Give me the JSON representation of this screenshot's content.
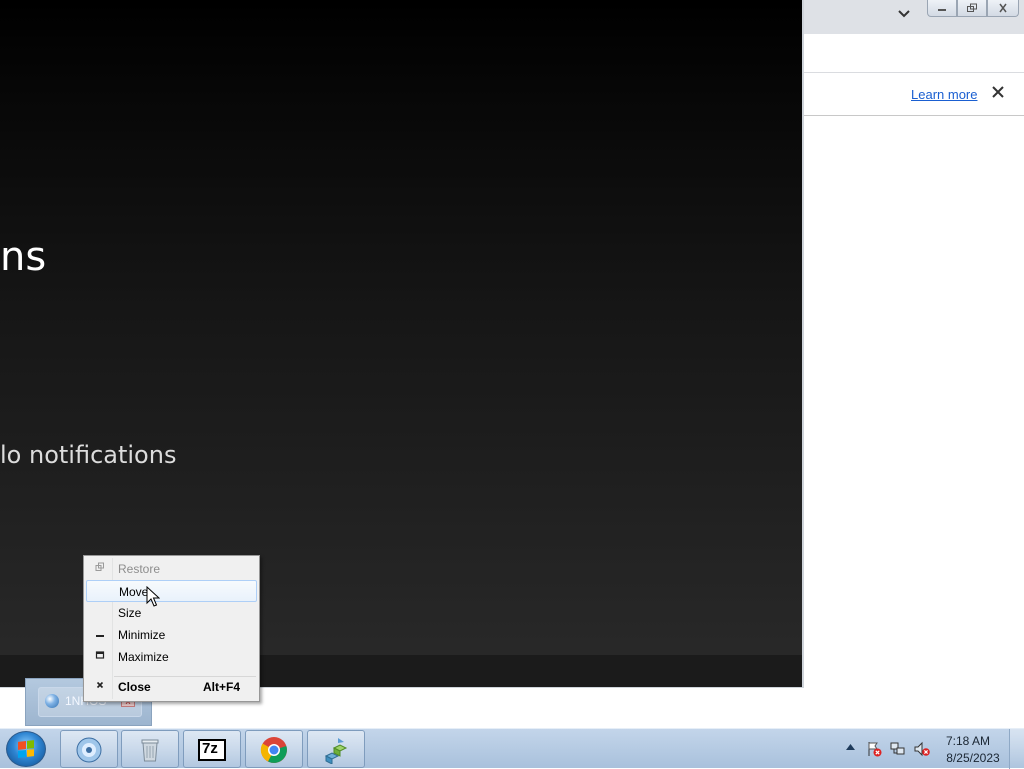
{
  "chrome": {
    "infobar": {
      "learn_more": "Learn more"
    }
  },
  "notifications_window": {
    "title_partial": "ns",
    "empty_partial": "lo notifications"
  },
  "thumbnail": {
    "label": "1NHOS"
  },
  "context_menu": {
    "items": [
      {
        "label": "Restore",
        "icon": "restore-icon",
        "disabled": true
      },
      {
        "label": "Move",
        "icon": "",
        "highlighted": true
      },
      {
        "label": "Size",
        "icon": ""
      },
      {
        "label": "Minimize",
        "icon": "minimize-icon"
      },
      {
        "label": "Maximize",
        "icon": "maximize-icon"
      },
      {
        "label": "Close",
        "icon": "close-icon",
        "accelerator": "Alt+F4",
        "bold": true
      }
    ]
  },
  "taskbar": {
    "pinned": [
      "media-player",
      "recycle-bin",
      "7zip",
      "chrome",
      "network-app"
    ],
    "seven_zip_label": "7z",
    "clock": {
      "time": "7:18 AM",
      "date": "8/25/2023"
    }
  },
  "colors": {
    "accent_link": "#1a5fd1",
    "taskbar": "#b5cae2",
    "menu_highlight": "#e9f2fb"
  }
}
